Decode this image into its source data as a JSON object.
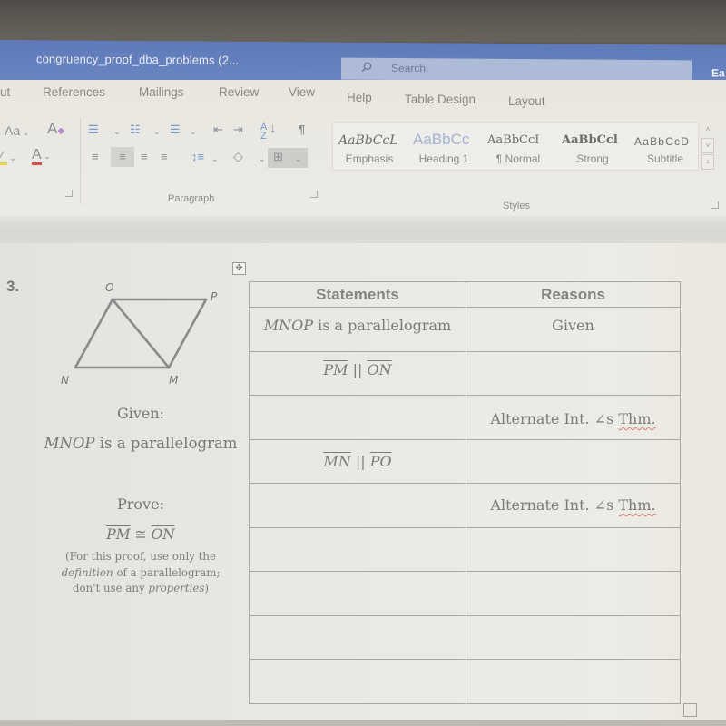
{
  "window": {
    "doc_title": "congruency_proof_dba_problems (2...",
    "search_placeholder": "Search",
    "user_initials": "Ea"
  },
  "ribbon": {
    "tabs": [
      {
        "label": "ut"
      },
      {
        "label": "References"
      },
      {
        "label": "Mailings"
      },
      {
        "label": "Review"
      },
      {
        "label": "View"
      },
      {
        "label": "Help"
      },
      {
        "label": "Table Design"
      },
      {
        "label": "Layout"
      }
    ],
    "font_group": {
      "change_case": "Aa",
      "clear_format_icon": "A",
      "font_color_icon": "A"
    },
    "paragraph_group": {
      "label": "Paragraph"
    },
    "styles_group": {
      "label": "Styles",
      "items": [
        {
          "preview": "AaBbCcL",
          "name": "Emphasis"
        },
        {
          "preview": "AaBbCc",
          "name": "Heading 1"
        },
        {
          "preview": "AaBbCcI",
          "name": "¶ Normal"
        },
        {
          "preview": "AaBbCcl",
          "name": "Strong"
        },
        {
          "preview": "AaBbCcD",
          "name": "Subtitle"
        }
      ]
    }
  },
  "document": {
    "problem_number": "3.",
    "diagram": {
      "vertices": {
        "O": "O",
        "P": "P",
        "N": "N",
        "M": "M"
      }
    },
    "given_label": "Given:",
    "given_italic": "MNOP",
    "given_rest": " is a parallelogram",
    "prove_label": "Prove:",
    "prove_seg1": "PM",
    "prove_rel": " ≅ ",
    "prove_seg2": "ON",
    "note_line1": "(For this proof, use only the",
    "note_italic1": "definition",
    "note_line2": " of a parallelogram;",
    "note_line3": "don't use any ",
    "note_italic2": "properties",
    "note_end": ")",
    "table": {
      "headers": [
        "Statements",
        "Reasons"
      ],
      "rows": [
        {
          "stmt_italic": "MNOP",
          "stmt_rest": " is a parallelogram",
          "reason": "Given"
        },
        {
          "seg1": "PM",
          "rel": " || ",
          "seg2": "ON",
          "reason": ""
        },
        {
          "stmt": "",
          "reason_pre": "Alternate Int. ∠s ",
          "reason_squiggle": "Thm."
        },
        {
          "seg1": "MN",
          "rel": " || ",
          "seg2": "PO",
          "reason": ""
        },
        {
          "stmt": "",
          "reason_pre": "Alternate Int. ∠s ",
          "reason_squiggle": "Thm."
        },
        {
          "stmt": "",
          "reason": ""
        },
        {
          "stmt": "",
          "reason": ""
        },
        {
          "stmt": "",
          "reason": ""
        },
        {
          "stmt": "",
          "reason": ""
        }
      ]
    }
  }
}
